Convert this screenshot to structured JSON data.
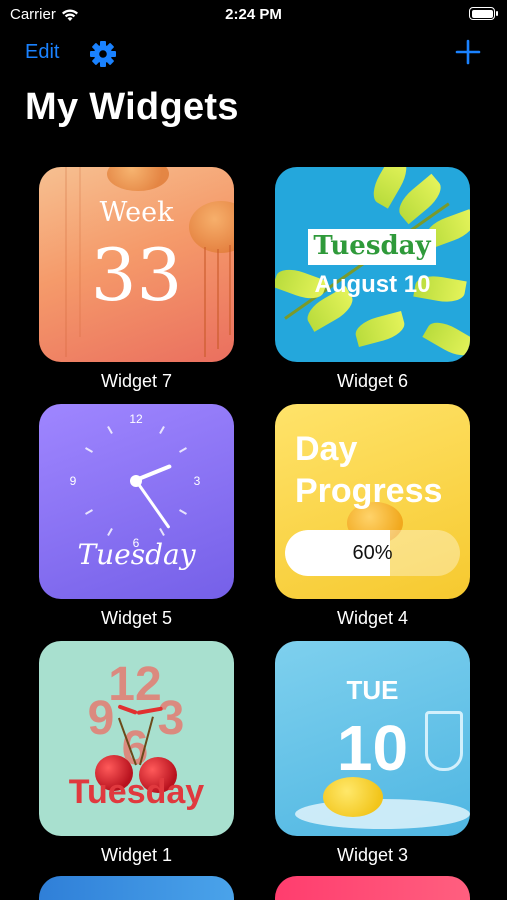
{
  "status_bar": {
    "carrier": "Carrier",
    "time": "2:24 PM"
  },
  "nav": {
    "edit_label": "Edit",
    "settings_icon": "gear-icon",
    "add_icon": "plus-icon",
    "accent_color": "#1a82ff"
  },
  "title": "My Widgets",
  "widgets": [
    {
      "name": "Widget 7",
      "line1": "Week",
      "line2": "33"
    },
    {
      "name": "Widget 6",
      "line1": "Tuesday",
      "line2": "August 10"
    },
    {
      "name": "Widget 5",
      "numerals": [
        "12",
        "3",
        "6",
        "9"
      ],
      "day": "Tuesday"
    },
    {
      "name": "Widget 4",
      "line1": "Day",
      "line2": "Progress",
      "progress_label": "60%",
      "progress": 0.6
    },
    {
      "name": "Widget 1",
      "numerals": [
        "12",
        "9",
        "3",
        "6"
      ],
      "day": "Tuesday"
    },
    {
      "name": "Widget 3",
      "line1": "TUE",
      "line2": "10"
    }
  ]
}
